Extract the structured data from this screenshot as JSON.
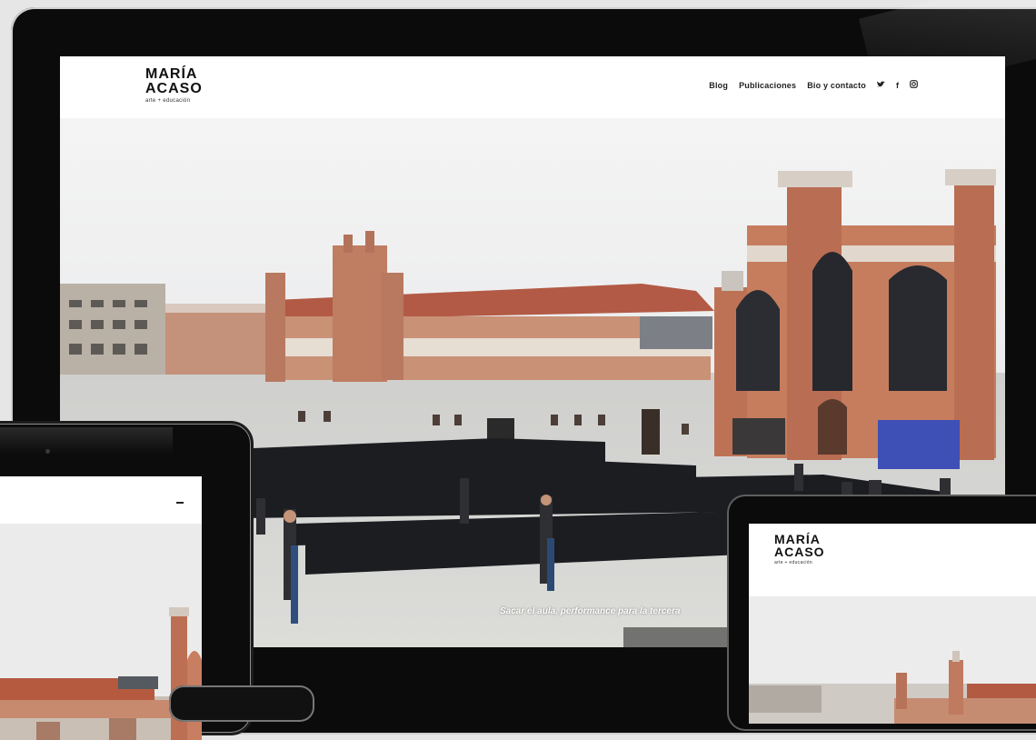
{
  "site": {
    "logo_line1": "MARÍA",
    "logo_line2": "ACASO",
    "logo_tagline": "arte + educación"
  },
  "nav": {
    "items": [
      {
        "label": "Blog"
      },
      {
        "label": "Publicaciones"
      },
      {
        "label": "Bio y contacto"
      }
    ],
    "social": [
      {
        "icon": "twitter-icon",
        "glyph": "✉"
      },
      {
        "icon": "facebook-icon",
        "glyph": "f"
      },
      {
        "icon": "instagram-icon",
        "glyph": "▣"
      }
    ]
  },
  "hero": {
    "caption": "Sacar el aula, performance para la tercera"
  },
  "colors": {
    "brick": "#b76a4a",
    "sky": "#ececec",
    "pavement": "#d5d5d2",
    "fabric": "#1c1d21",
    "banner": "#3e4fb5"
  }
}
